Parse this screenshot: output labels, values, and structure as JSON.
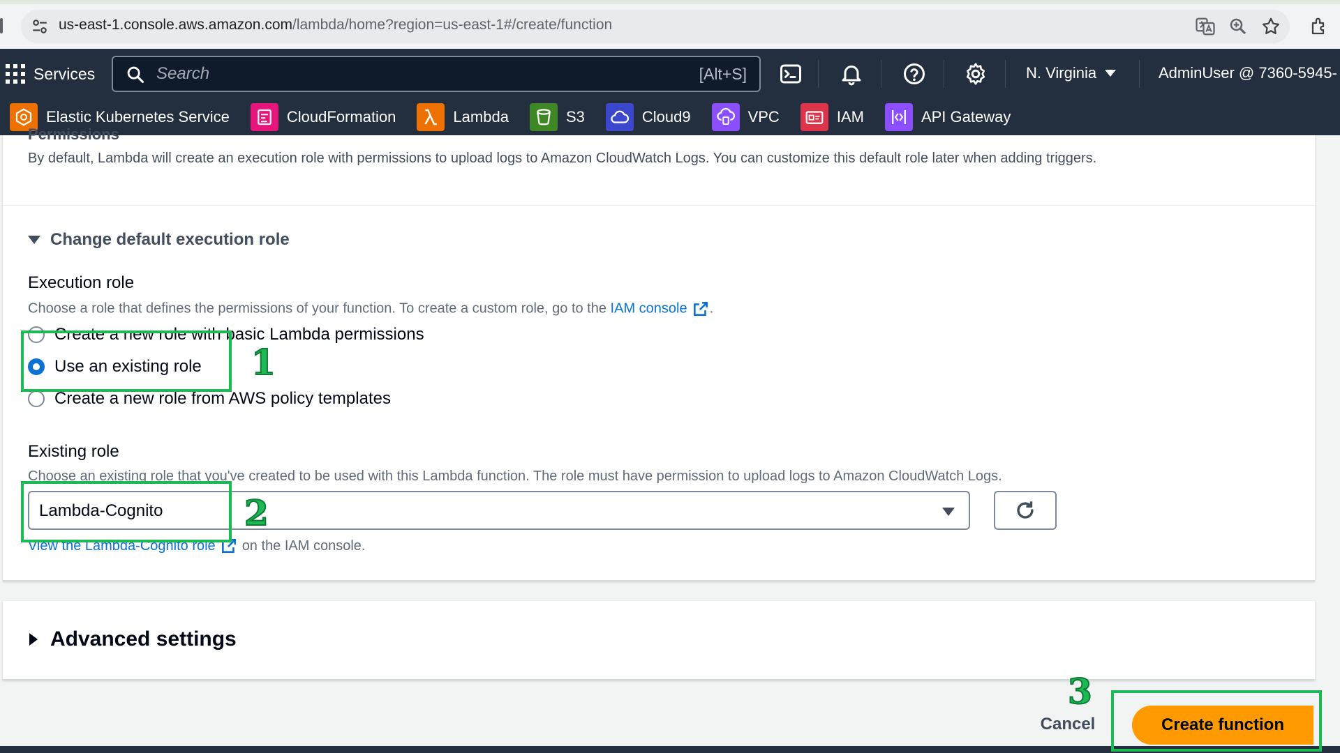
{
  "browser": {
    "url_host": "us-east-1.console.aws.amazon.com",
    "url_path": "/lambda/home?region=us-east-1#/create/function"
  },
  "aws_nav": {
    "services_label": "Services",
    "search_placeholder": "Search",
    "search_shortcut": "[Alt+S]",
    "region_label": "N. Virginia",
    "account_label": "AdminUser @ 7360-5945-"
  },
  "favorites": [
    {
      "label": "Elastic Kubernetes Service",
      "color": "#ed7100"
    },
    {
      "label": "CloudFormation",
      "color": "#e7157b"
    },
    {
      "label": "Lambda",
      "color": "#ed7100"
    },
    {
      "label": "S3",
      "color": "#3f8624"
    },
    {
      "label": "Cloud9",
      "color": "#3b48cc"
    },
    {
      "label": "VPC",
      "color": "#8c4fff"
    },
    {
      "label": "IAM",
      "color": "#dd344c"
    },
    {
      "label": "API Gateway",
      "color": "#8c4fff"
    }
  ],
  "permissions": {
    "heading_partial": "Permissions",
    "description": "By default, Lambda will create an execution role with permissions to upload logs to Amazon CloudWatch Logs. You can customize this default role later when adding triggers."
  },
  "execution_role": {
    "expander_title": "Change default execution role",
    "label": "Execution role",
    "hint_prefix": "Choose a role that defines the permissions of your function. To create a custom role, go to the",
    "hint_link": "IAM console",
    "hint_suffix": ".",
    "options": [
      {
        "label": "Create a new role with basic Lambda permissions",
        "checked": false
      },
      {
        "label": "Use an existing role",
        "checked": true
      },
      {
        "label": "Create a new role from AWS policy templates",
        "checked": false
      }
    ]
  },
  "existing_role": {
    "label": "Existing role",
    "hint": "Choose an existing role that you've created to be used with this Lambda function. The role must have permission to upload logs to Amazon CloudWatch Logs.",
    "selected_value": "Lambda-Cognito",
    "view_link": "View the Lambda-Cognito role",
    "view_suffix": "on the IAM console."
  },
  "advanced": {
    "title": "Advanced settings"
  },
  "footer": {
    "cancel_label": "Cancel",
    "create_label": "Create function"
  },
  "annotations": {
    "step1": "1",
    "step2": "2",
    "step3": "3",
    "color": "#1db954"
  }
}
